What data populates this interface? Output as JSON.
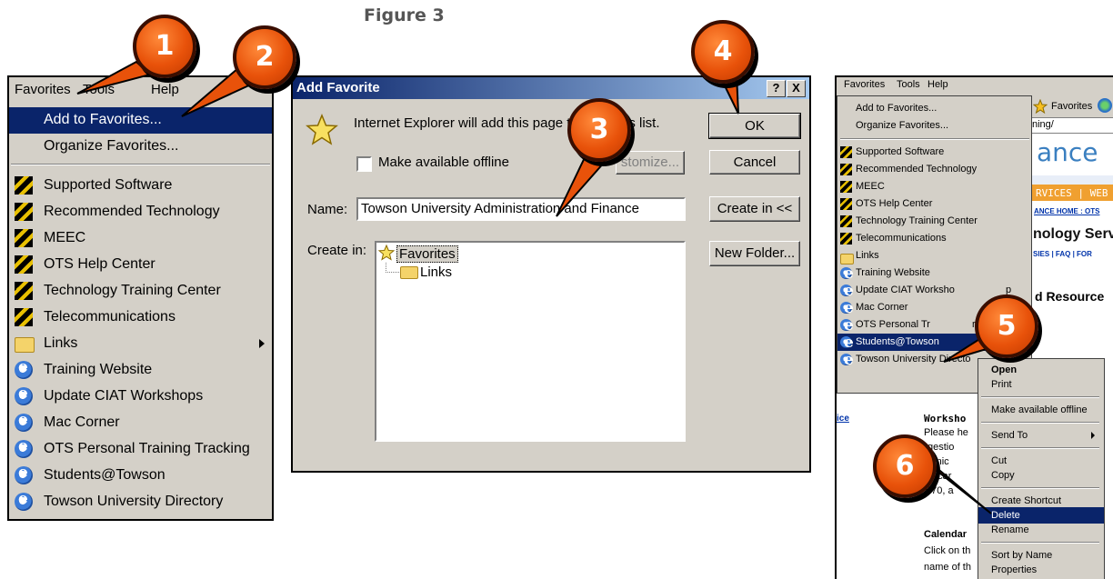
{
  "figure_title": "Figure 3",
  "left_menu": {
    "menubar": [
      "Favorites",
      "Tools",
      "Help"
    ],
    "items_top": [
      "Add to Favorites...",
      "Organize Favorites..."
    ],
    "items": [
      {
        "label": "Supported Software",
        "icon": "flag-icon"
      },
      {
        "label": "Recommended Technology",
        "icon": "flag-icon"
      },
      {
        "label": "MEEC",
        "icon": "flag-icon"
      },
      {
        "label": "OTS Help Center",
        "icon": "flag-icon"
      },
      {
        "label": "Technology Training Center",
        "icon": "flag-icon"
      },
      {
        "label": "Telecommunications",
        "icon": "flag-icon"
      },
      {
        "label": "Links",
        "icon": "folder-icon"
      },
      {
        "label": "Training Website",
        "icon": "ie-page-icon"
      },
      {
        "label": "Update CIAT Workshops",
        "icon": "ie-page-icon"
      },
      {
        "label": "Mac Corner",
        "icon": "ie-page-icon"
      },
      {
        "label": "OTS Personal Training Tracking",
        "icon": "ie-page-icon"
      },
      {
        "label": "Students@Towson",
        "icon": "ie-page-icon"
      },
      {
        "label": "Towson University Directory",
        "icon": "ie-page-icon"
      }
    ]
  },
  "dialog": {
    "title": "Add Favorite",
    "help_btn": "?",
    "close_btn": "X",
    "message_a": "Internet Explorer will add this page t",
    "message_b": "es list.",
    "offline_label": "Make available offline",
    "customize_label": "stomize...",
    "name_label": "Name:",
    "name_value": "Towson University  Administration and Finance",
    "create_in_label": "Create in:",
    "tree_root": "Favorites",
    "tree_child": "Links",
    "ok_label": "OK",
    "cancel_label": "Cancel",
    "create_in_btn": "Create in <<",
    "new_folder_btn": "New Folder..."
  },
  "right_shot": {
    "menubar": [
      "Favorites",
      "Tools",
      "Help"
    ],
    "menu_top": [
      "Add to Favorites...",
      "Organize Favorites..."
    ],
    "menu_items": [
      "Supported Software",
      "Recommended Technology",
      "MEEC",
      "OTS Help Center",
      "Technology Training Center",
      "Telecommunications",
      "Links",
      "Training Website",
      "Update CIAT Worksho",
      "Mac Corner",
      "OTS Personal Tr",
      "Students@Towson",
      "Towson University Directo"
    ],
    "menu_tail": [
      "p",
      "racking"
    ],
    "context_menu": [
      "Open",
      "Print",
      "Make available offline",
      "Send To",
      "Cut",
      "Copy",
      "Create Shortcut",
      "Delete",
      "Rename",
      "Sort by Name",
      "Properties"
    ],
    "toolbar_favorites": "Favorites",
    "address": "ning/",
    "web_ance": "ance",
    "web_services": "RVICES | WEB",
    "web_nav": "ANCE HOME : OTS",
    "web_heading": "nology Servi",
    "web_links": "SIES | FAQ | FOR",
    "web_resource": "d Resource",
    "web_ice": "ice",
    "web_workshop": "Worksho",
    "web_lines": [
      "Please he",
      "gestio",
      "chnic",
      "e car",
      "070, a"
    ],
    "web_calendar": "Calendar",
    "web_click": [
      "Click on th",
      "name of th"
    ]
  },
  "callouts": [
    "1",
    "2",
    "3",
    "4",
    "5",
    "6"
  ],
  "colors": {
    "highlight": "#0a246a",
    "callout": "#e8520a",
    "chrome": "#d4d0c8"
  }
}
